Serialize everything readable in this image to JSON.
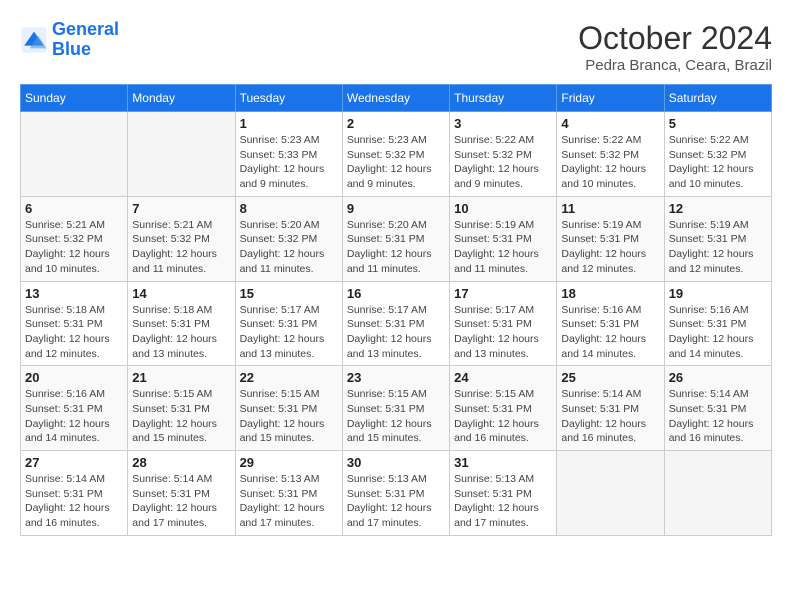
{
  "logo": {
    "line1": "General",
    "line2": "Blue"
  },
  "title": "October 2024",
  "subtitle": "Pedra Branca, Ceara, Brazil",
  "days_of_week": [
    "Sunday",
    "Monday",
    "Tuesday",
    "Wednesday",
    "Thursday",
    "Friday",
    "Saturday"
  ],
  "weeks": [
    [
      {
        "day": "",
        "info": ""
      },
      {
        "day": "",
        "info": ""
      },
      {
        "day": "1",
        "info": "Sunrise: 5:23 AM\nSunset: 5:33 PM\nDaylight: 12 hours and 9 minutes."
      },
      {
        "day": "2",
        "info": "Sunrise: 5:23 AM\nSunset: 5:32 PM\nDaylight: 12 hours and 9 minutes."
      },
      {
        "day": "3",
        "info": "Sunrise: 5:22 AM\nSunset: 5:32 PM\nDaylight: 12 hours and 9 minutes."
      },
      {
        "day": "4",
        "info": "Sunrise: 5:22 AM\nSunset: 5:32 PM\nDaylight: 12 hours and 10 minutes."
      },
      {
        "day": "5",
        "info": "Sunrise: 5:22 AM\nSunset: 5:32 PM\nDaylight: 12 hours and 10 minutes."
      }
    ],
    [
      {
        "day": "6",
        "info": "Sunrise: 5:21 AM\nSunset: 5:32 PM\nDaylight: 12 hours and 10 minutes."
      },
      {
        "day": "7",
        "info": "Sunrise: 5:21 AM\nSunset: 5:32 PM\nDaylight: 12 hours and 11 minutes."
      },
      {
        "day": "8",
        "info": "Sunrise: 5:20 AM\nSunset: 5:32 PM\nDaylight: 12 hours and 11 minutes."
      },
      {
        "day": "9",
        "info": "Sunrise: 5:20 AM\nSunset: 5:31 PM\nDaylight: 12 hours and 11 minutes."
      },
      {
        "day": "10",
        "info": "Sunrise: 5:19 AM\nSunset: 5:31 PM\nDaylight: 12 hours and 11 minutes."
      },
      {
        "day": "11",
        "info": "Sunrise: 5:19 AM\nSunset: 5:31 PM\nDaylight: 12 hours and 12 minutes."
      },
      {
        "day": "12",
        "info": "Sunrise: 5:19 AM\nSunset: 5:31 PM\nDaylight: 12 hours and 12 minutes."
      }
    ],
    [
      {
        "day": "13",
        "info": "Sunrise: 5:18 AM\nSunset: 5:31 PM\nDaylight: 12 hours and 12 minutes."
      },
      {
        "day": "14",
        "info": "Sunrise: 5:18 AM\nSunset: 5:31 PM\nDaylight: 12 hours and 13 minutes."
      },
      {
        "day": "15",
        "info": "Sunrise: 5:17 AM\nSunset: 5:31 PM\nDaylight: 12 hours and 13 minutes."
      },
      {
        "day": "16",
        "info": "Sunrise: 5:17 AM\nSunset: 5:31 PM\nDaylight: 12 hours and 13 minutes."
      },
      {
        "day": "17",
        "info": "Sunrise: 5:17 AM\nSunset: 5:31 PM\nDaylight: 12 hours and 13 minutes."
      },
      {
        "day": "18",
        "info": "Sunrise: 5:16 AM\nSunset: 5:31 PM\nDaylight: 12 hours and 14 minutes."
      },
      {
        "day": "19",
        "info": "Sunrise: 5:16 AM\nSunset: 5:31 PM\nDaylight: 12 hours and 14 minutes."
      }
    ],
    [
      {
        "day": "20",
        "info": "Sunrise: 5:16 AM\nSunset: 5:31 PM\nDaylight: 12 hours and 14 minutes."
      },
      {
        "day": "21",
        "info": "Sunrise: 5:15 AM\nSunset: 5:31 PM\nDaylight: 12 hours and 15 minutes."
      },
      {
        "day": "22",
        "info": "Sunrise: 5:15 AM\nSunset: 5:31 PM\nDaylight: 12 hours and 15 minutes."
      },
      {
        "day": "23",
        "info": "Sunrise: 5:15 AM\nSunset: 5:31 PM\nDaylight: 12 hours and 15 minutes."
      },
      {
        "day": "24",
        "info": "Sunrise: 5:15 AM\nSunset: 5:31 PM\nDaylight: 12 hours and 16 minutes."
      },
      {
        "day": "25",
        "info": "Sunrise: 5:14 AM\nSunset: 5:31 PM\nDaylight: 12 hours and 16 minutes."
      },
      {
        "day": "26",
        "info": "Sunrise: 5:14 AM\nSunset: 5:31 PM\nDaylight: 12 hours and 16 minutes."
      }
    ],
    [
      {
        "day": "27",
        "info": "Sunrise: 5:14 AM\nSunset: 5:31 PM\nDaylight: 12 hours and 16 minutes."
      },
      {
        "day": "28",
        "info": "Sunrise: 5:14 AM\nSunset: 5:31 PM\nDaylight: 12 hours and 17 minutes."
      },
      {
        "day": "29",
        "info": "Sunrise: 5:13 AM\nSunset: 5:31 PM\nDaylight: 12 hours and 17 minutes."
      },
      {
        "day": "30",
        "info": "Sunrise: 5:13 AM\nSunset: 5:31 PM\nDaylight: 12 hours and 17 minutes."
      },
      {
        "day": "31",
        "info": "Sunrise: 5:13 AM\nSunset: 5:31 PM\nDaylight: 12 hours and 17 minutes."
      },
      {
        "day": "",
        "info": ""
      },
      {
        "day": "",
        "info": ""
      }
    ]
  ]
}
